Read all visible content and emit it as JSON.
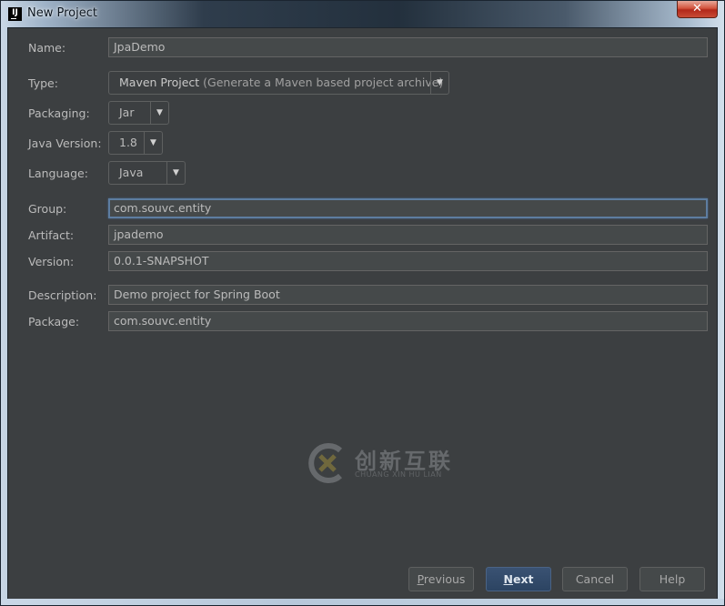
{
  "window": {
    "app_icon": "IJ",
    "title": "New Project",
    "close_glyph": "✕"
  },
  "form": {
    "name": {
      "label": "Name:",
      "value": "JpaDemo"
    },
    "type": {
      "label": "Type:",
      "value_main": "Maven Project",
      "value_desc": " (Generate a Maven based project archive)"
    },
    "packaging": {
      "label": "Packaging:",
      "value": "Jar"
    },
    "java_version": {
      "label": "Java Version:",
      "value": "1.8"
    },
    "language": {
      "label": "Language:",
      "value": "Java"
    },
    "group": {
      "label": "Group:",
      "value": "com.souvc.entity"
    },
    "artifact": {
      "label": "Artifact:",
      "value": "jpademo"
    },
    "version": {
      "label": "Version:",
      "value": "0.0.1-SNAPSHOT"
    },
    "description": {
      "label": "Description:",
      "value": "Demo project for Spring Boot"
    },
    "package": {
      "label": "Package:",
      "value": "com.souvc.entity"
    }
  },
  "dropdown_arrow": "▼",
  "watermark": {
    "text": "创新互联",
    "subtext": "CHUANG XIN HU LIAN"
  },
  "buttons": {
    "previous": {
      "mnemonic": "P",
      "rest": "revious"
    },
    "next": {
      "mnemonic": "N",
      "rest": "ext"
    },
    "cancel": "Cancel",
    "help": "Help"
  }
}
